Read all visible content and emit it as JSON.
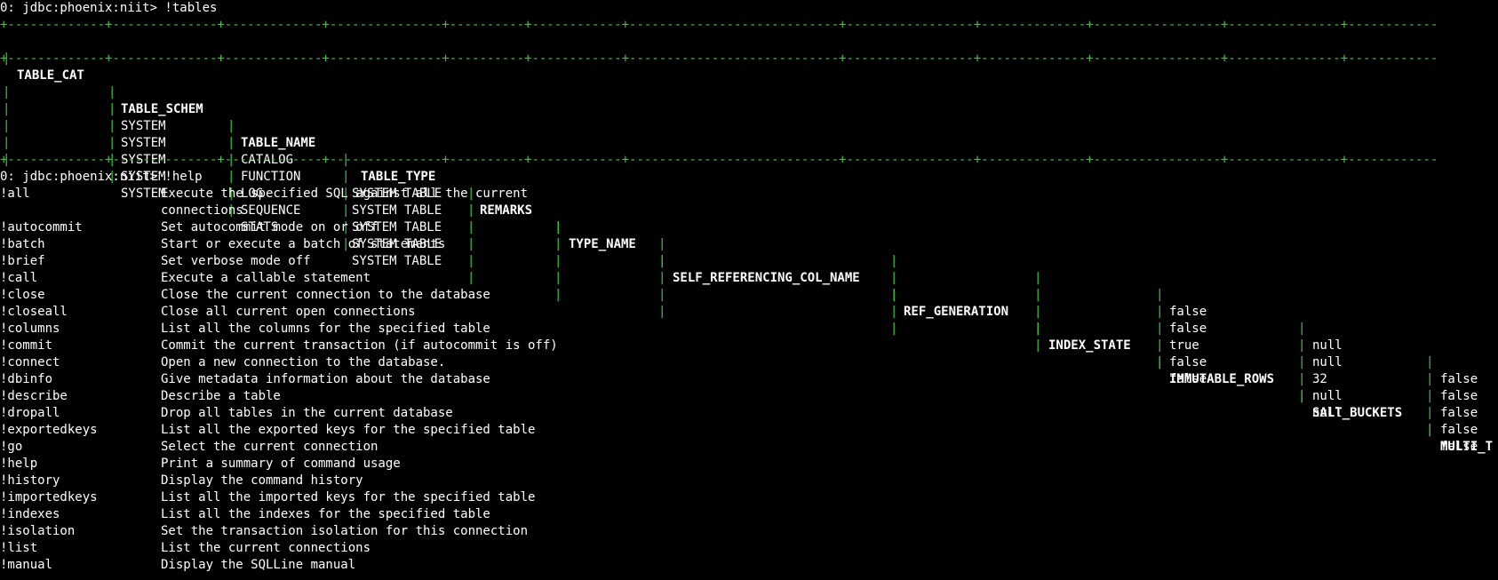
{
  "terminal": {
    "prompt1": "0: jdbc:phoenix:niit> !tables",
    "prompt2": "0: jdbc:phoenix:niit> !help",
    "border": "+-------------+--------------+-------------+---------------+----------+------------+----------------------------+-----------------+--------------+-----------------+---------------+------------",
    "headers": [
      "TABLE_CAT",
      "TABLE_SCHEM",
      "TABLE_NAME",
      "TABLE_TYPE",
      "REMARKS",
      "TYPE_NAME",
      "SELF_REFERENCING_COL_NAME",
      "REF_GENERATION",
      "INDEX_STATE",
      "IMMUTABLE_ROWS",
      "SALT_BUCKETS",
      "MULTI_T"
    ],
    "rows": [
      [
        "",
        "SYSTEM",
        "CATALOG",
        "SYSTEM TABLE",
        "",
        "",
        "",
        "",
        "",
        "false",
        "null",
        "false"
      ],
      [
        "",
        "SYSTEM",
        "FUNCTION",
        "SYSTEM TABLE",
        "",
        "",
        "",
        "",
        "",
        "false",
        "null",
        "false"
      ],
      [
        "",
        "SYSTEM",
        "LOG",
        "SYSTEM TABLE",
        "",
        "",
        "",
        "",
        "",
        "true",
        "32",
        "false"
      ],
      [
        "",
        "SYSTEM",
        "SEQUENCE",
        "SYSTEM TABLE",
        "",
        "",
        "",
        "",
        "",
        "false",
        "null",
        "false"
      ],
      [
        "",
        "SYSTEM",
        "STATS",
        "SYSTEM TABLE",
        "",
        "",
        "",
        "",
        "",
        "false",
        "null",
        "false"
      ]
    ],
    "help": [
      {
        "cmd": "!all",
        "desc": "Execute the specified SQL against all the current"
      },
      {
        "cmd": "",
        "desc": "connections"
      },
      {
        "cmd": "!autocommit",
        "desc": "Set autocommit mode on or off"
      },
      {
        "cmd": "!batch",
        "desc": "Start or execute a batch of statements"
      },
      {
        "cmd": "!brief",
        "desc": "Set verbose mode off"
      },
      {
        "cmd": "!call",
        "desc": "Execute a callable statement"
      },
      {
        "cmd": "!close",
        "desc": "Close the current connection to the database"
      },
      {
        "cmd": "!closeall",
        "desc": "Close all current open connections"
      },
      {
        "cmd": "!columns",
        "desc": "List all the columns for the specified table"
      },
      {
        "cmd": "!commit",
        "desc": "Commit the current transaction (if autocommit is off)"
      },
      {
        "cmd": "!connect",
        "desc": "Open a new connection to the database."
      },
      {
        "cmd": "!dbinfo",
        "desc": "Give metadata information about the database"
      },
      {
        "cmd": "!describe",
        "desc": "Describe a table"
      },
      {
        "cmd": "!dropall",
        "desc": "Drop all tables in the current database"
      },
      {
        "cmd": "!exportedkeys",
        "desc": "List all the exported keys for the specified table"
      },
      {
        "cmd": "!go",
        "desc": "Select the current connection"
      },
      {
        "cmd": "!help",
        "desc": "Print a summary of command usage"
      },
      {
        "cmd": "!history",
        "desc": "Display the command history"
      },
      {
        "cmd": "!importedkeys",
        "desc": "List all the imported keys for the specified table"
      },
      {
        "cmd": "!indexes",
        "desc": "List all the indexes for the specified table"
      },
      {
        "cmd": "!isolation",
        "desc": "Set the transaction isolation for this connection"
      },
      {
        "cmd": "!list",
        "desc": "List the current connections"
      },
      {
        "cmd": "!manual",
        "desc": "Display the SQLLine manual"
      }
    ]
  }
}
